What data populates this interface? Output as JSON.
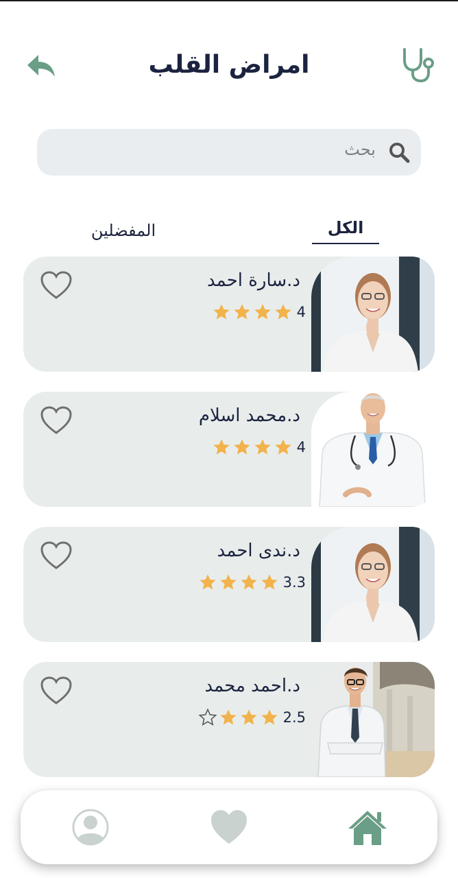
{
  "header": {
    "title": "امراض القلب",
    "back_icon": "back-arrow-icon",
    "stethoscope_icon": "stethoscope-icon"
  },
  "search": {
    "placeholder": "بحث",
    "icon": "search-icon"
  },
  "tabs": [
    {
      "label": "الكل",
      "active": true
    },
    {
      "label": "المفضلين",
      "active": false
    }
  ],
  "doctors": [
    {
      "name": "د.سارة احمد",
      "rating": "4",
      "stars_filled": 4,
      "stars_empty": 0,
      "photo": "female-doctor-photo"
    },
    {
      "name": "د.محمد اسلام",
      "rating": "4",
      "stars_filled": 4,
      "stars_empty": 0,
      "photo": "male-senior-doctor-photo"
    },
    {
      "name": "د.ندى احمد",
      "rating": "3.3",
      "stars_filled": 4,
      "stars_empty": 0,
      "photo": "female-doctor-photo"
    },
    {
      "name": "د.احمد محمد",
      "rating": "2.5",
      "stars_filled": 3,
      "stars_empty": 1,
      "photo": "male-young-doctor-photo"
    }
  ],
  "bottom_nav": [
    {
      "name": "profile",
      "icon": "user-icon"
    },
    {
      "name": "favorites",
      "icon": "heart-icon"
    },
    {
      "name": "home",
      "icon": "home-icon",
      "active": true
    }
  ],
  "colors": {
    "primary": "#1c2340",
    "accent_green": "#6a9e86",
    "card_bg": "#e8edeb",
    "search_bg": "#eaedf0",
    "star": "#f2b24c",
    "inactive_icon": "#c9d2cf"
  }
}
